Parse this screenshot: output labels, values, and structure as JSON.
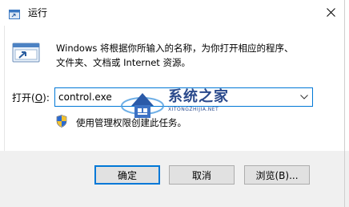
{
  "window": {
    "title": "运行",
    "close_icon": "close-icon"
  },
  "body": {
    "icon": "run-app-icon",
    "description_line1": "Windows 将根据你所输入的名称，为你打开相应的程序、",
    "description_line2": "文件夹、文档或 Internet 资源。",
    "open_label_prefix": "打开(",
    "open_label_hotkey": "O",
    "open_label_suffix": "):",
    "open_value": "control.exe",
    "admin_icon": "uac-shield-icon",
    "admin_text": "使用管理权限创建此任务。"
  },
  "watermark": {
    "title": "系统之家",
    "subtitle": "XITONGZHIJIA.NET"
  },
  "buttons": {
    "ok": "确定",
    "cancel": "取消",
    "browse": "浏览(B)..."
  },
  "colors": {
    "accent": "#0078d7",
    "footer": "#f0f0f0",
    "watermark": "#2b4a8c"
  }
}
